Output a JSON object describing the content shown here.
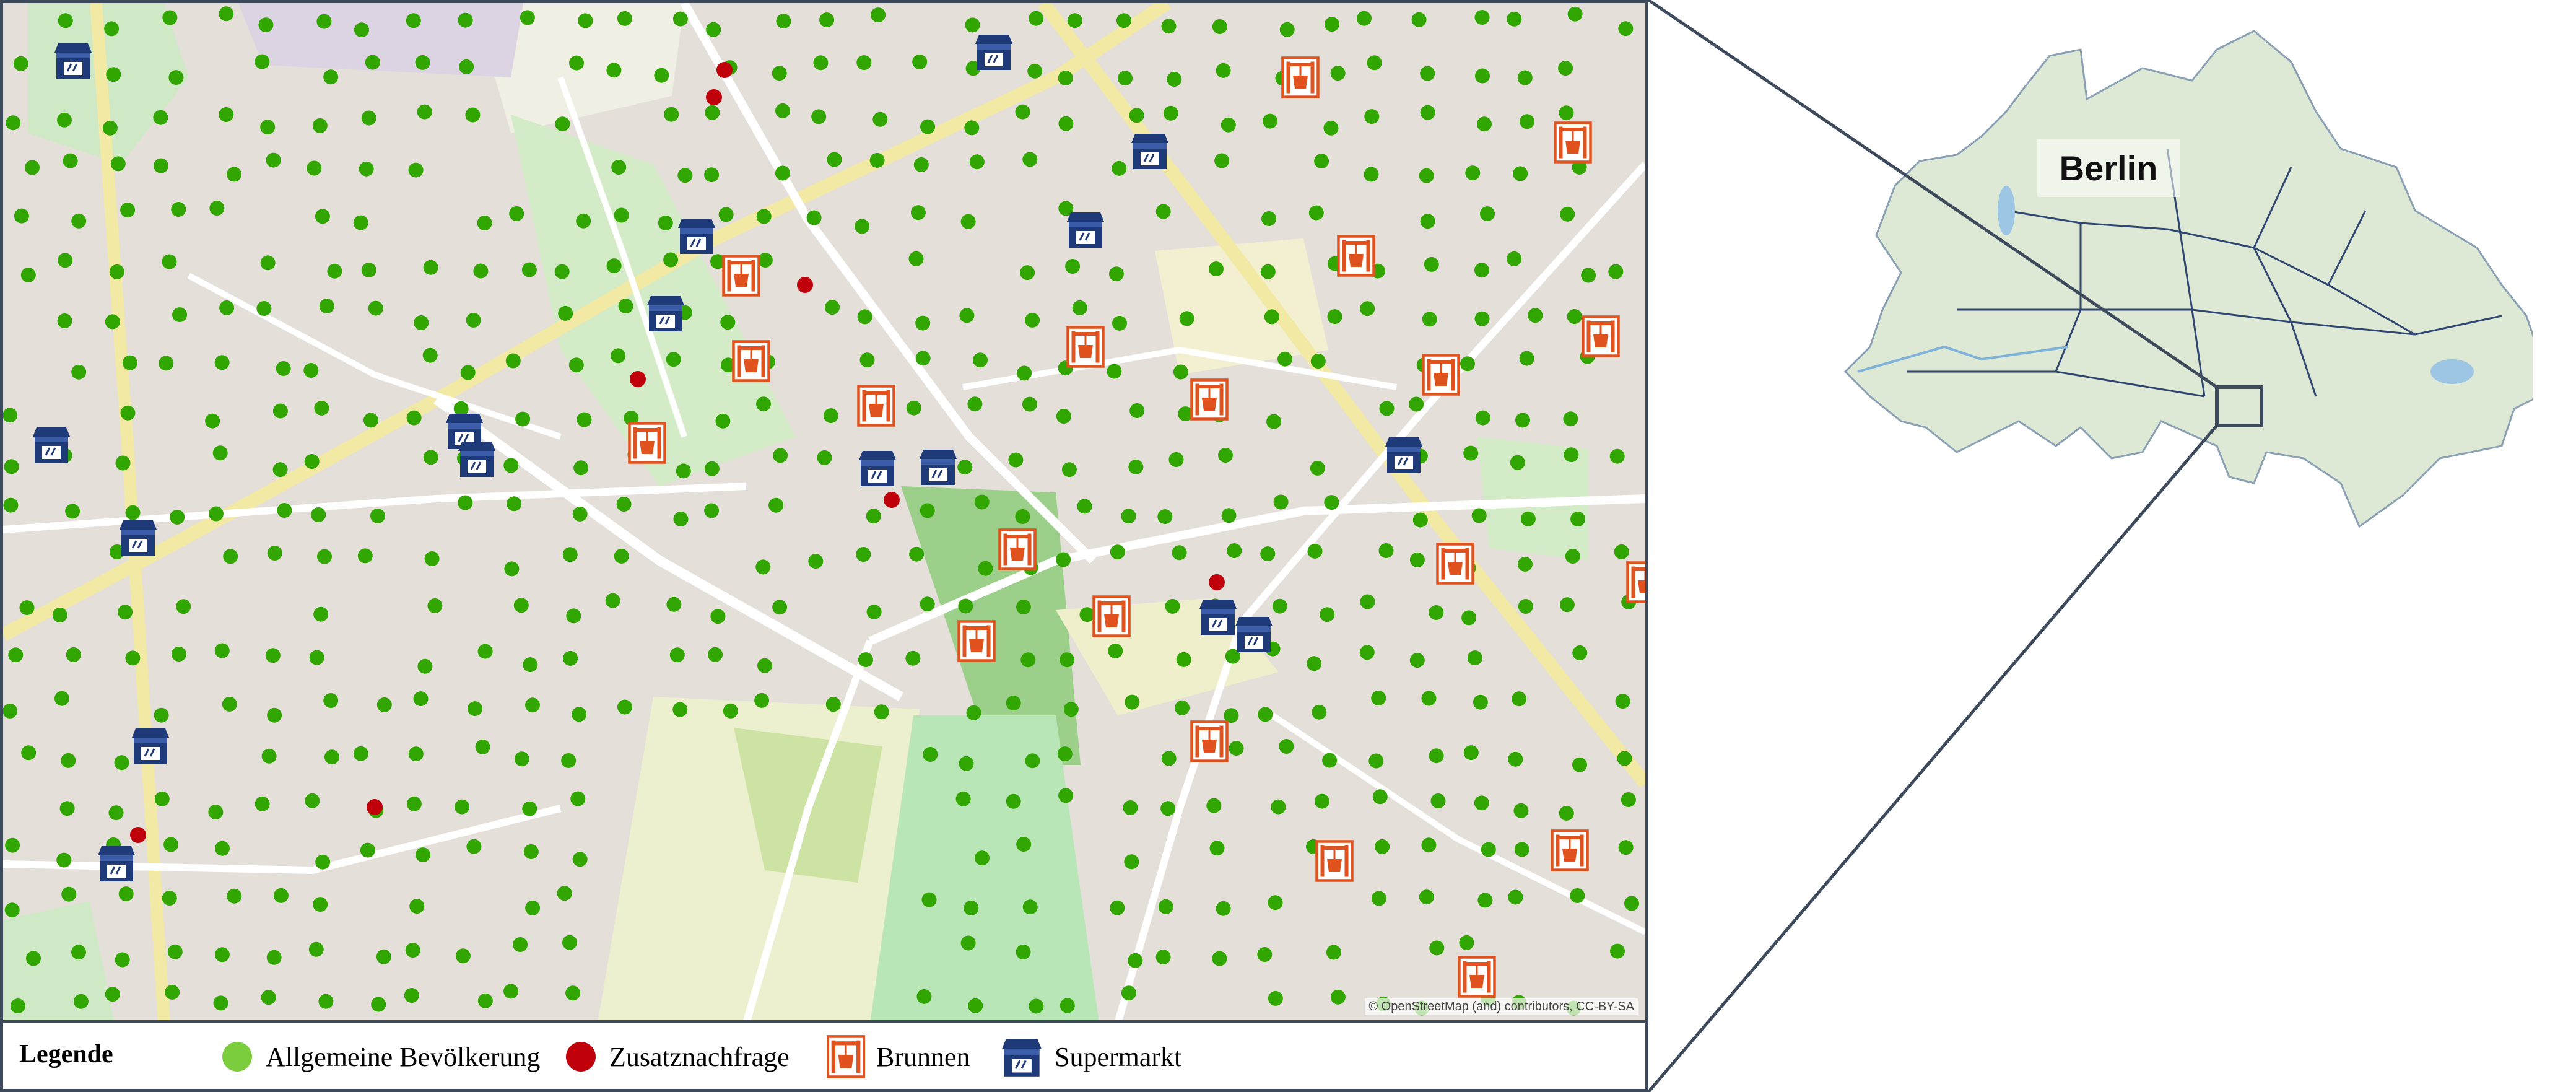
{
  "legend": {
    "title": "Legende",
    "items": [
      {
        "label": "Allgemeine Bevölkerung",
        "icon": "green-dot-icon",
        "color": "#7ccd3e"
      },
      {
        "label": "Zusatznachfrage",
        "icon": "red-dot-icon",
        "color": "#c0000b"
      },
      {
        "label": "Brunnen",
        "icon": "fountain-icon",
        "color": "#e0531f"
      },
      {
        "label": "Supermarkt",
        "icon": "supermarket-icon",
        "color": "#1f3a78"
      }
    ]
  },
  "map": {
    "attribution": "© OpenStreetMap (and) contributors, CC-BY-SA",
    "basemap": "OpenStreetMap",
    "point_color_population": "#32a600",
    "point_color_demand": "#c0000b",
    "fountain_color": "#e0531f",
    "supermarket_color": "#1f3a78"
  },
  "overview": {
    "title": "Berlin",
    "frame_color": "#3d4a5c"
  }
}
